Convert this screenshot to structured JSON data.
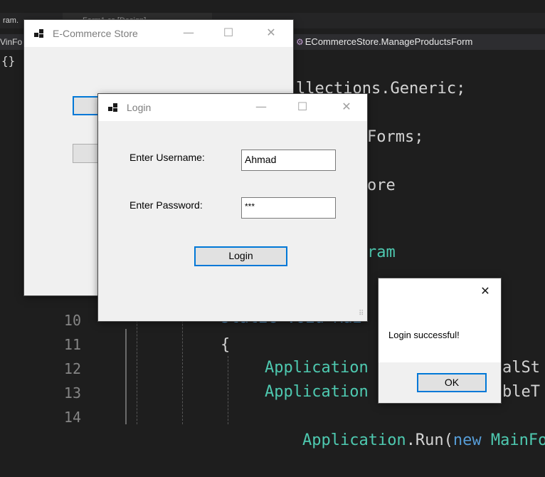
{
  "ide": {
    "tab_fragment": "ram.",
    "designer_tab": "Form1.cs [Design]",
    "nav_left": "VinFo",
    "nav_class": "ECommerceStore.ManageProductsForm",
    "code_lines": {
      "l1": [
        "llections.Generic;"
      ],
      "l2": [
        "Forms;"
      ],
      "l3": [
        "ore"
      ],
      "l4": [
        "ram"
      ],
      "l10_kw": "static void Mai",
      "l11": "{",
      "l12_a": "Application",
      "l12_b": "alSt",
      "l13_a": "Application",
      "l13_b": "bleT",
      "l14_a": "Application",
      "l14_b": ".Run(",
      "l14_c": "new",
      "l14_d": "MainFo"
    },
    "line_numbers": [
      "10",
      "11",
      "12",
      "13",
      "14"
    ]
  },
  "main_window": {
    "title": "E-Commerce Store",
    "icon": "windows-form-icon"
  },
  "login_window": {
    "title": "Login",
    "username_label": "Enter Username:",
    "username_value": "Ahmad",
    "password_label": "Enter Password:",
    "password_value": "***",
    "login_button": "Login"
  },
  "message_box": {
    "message": "Login successful!",
    "ok_button": "OK",
    "close_glyph": "✕"
  },
  "caption": {
    "minimize": "—",
    "maximize": "☐",
    "close": "✕"
  },
  "colors": {
    "accent": "#0078d7",
    "ide_bg": "#1e1e1e",
    "keyword": "#569cd6",
    "type": "#4ec9b0"
  }
}
